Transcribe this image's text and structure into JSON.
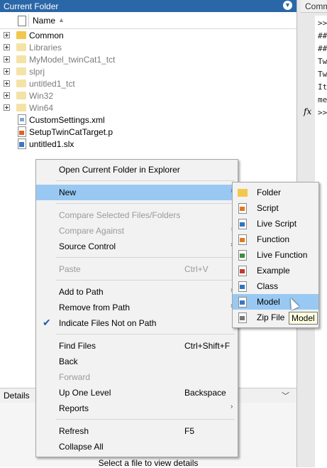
{
  "panel": {
    "title": "Current Folder",
    "column_name": "Name"
  },
  "command_window": {
    "title": "Comm",
    "lines": [
      ">>",
      "##",
      "##",
      "Tw",
      "Tw",
      "It",
      "me",
      ">>"
    ],
    "fx": "fx"
  },
  "files": [
    {
      "name": "Common",
      "type": "folder",
      "expandable": true,
      "greyed": false
    },
    {
      "name": "Libraries",
      "type": "folder",
      "expandable": true,
      "greyed": true
    },
    {
      "name": "MyModel_twinCat1_tct",
      "type": "folder",
      "expandable": true,
      "greyed": true
    },
    {
      "name": "slprj",
      "type": "folder",
      "expandable": true,
      "greyed": true
    },
    {
      "name": "untitled1_tct",
      "type": "folder",
      "expandable": true,
      "greyed": true
    },
    {
      "name": "Win32",
      "type": "folder",
      "expandable": true,
      "greyed": true
    },
    {
      "name": "Win64",
      "type": "folder",
      "expandable": true,
      "greyed": true
    },
    {
      "name": "CustomSettings.xml",
      "type": "xml",
      "expandable": false,
      "greyed": false
    },
    {
      "name": "SetupTwinCatTarget.p",
      "type": "p",
      "expandable": false,
      "greyed": false
    },
    {
      "name": "untitled1.slx",
      "type": "slx",
      "expandable": false,
      "greyed": false
    }
  ],
  "context_menu": {
    "open_explorer": "Open Current Folder in Explorer",
    "new": "New",
    "compare_selected": "Compare Selected Files/Folders",
    "compare_against": "Compare Against",
    "source_control": "Source Control",
    "paste": "Paste",
    "paste_shortcut": "Ctrl+V",
    "add_to_path": "Add to Path",
    "remove_from_path": "Remove from Path",
    "indicate_files": "Indicate Files Not on Path",
    "find_files": "Find Files",
    "find_files_shortcut": "Ctrl+Shift+F",
    "back": "Back",
    "forward": "Forward",
    "up_one_level": "Up One Level",
    "up_one_level_shortcut": "Backspace",
    "reports": "Reports",
    "refresh": "Refresh",
    "refresh_shortcut": "F5",
    "collapse_all": "Collapse All"
  },
  "new_submenu": {
    "folder": "Folder",
    "script": "Script",
    "live_script": "Live Script",
    "function": "Function",
    "live_function": "Live Function",
    "example": "Example",
    "class": "Class",
    "model": "Model",
    "zip_file": "Zip File"
  },
  "tooltip": "Model",
  "details": {
    "title": "Details",
    "message": "Select a file to view details"
  },
  "colors": {
    "panel_header": "#2a67a8",
    "highlight": "#99c9f2",
    "menu_bg": "#f2f2f2"
  }
}
